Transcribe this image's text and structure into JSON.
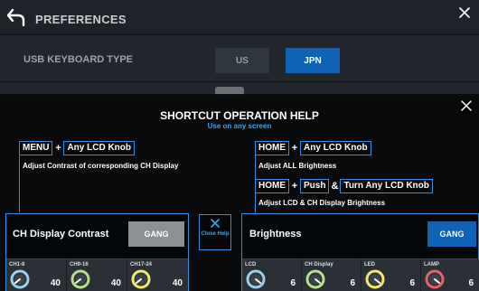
{
  "preferences": {
    "title": "PREFERENCES",
    "usb_keyboard_label": "USB KEYBOARD TYPE",
    "options": [
      "US",
      "JPN"
    ],
    "selected": "JPN"
  },
  "help": {
    "title": "SHORTCUT OPERATION HELP",
    "subtitle": "Use on any screen",
    "left": {
      "key1": "MENU",
      "plus": "+",
      "key2": "Any LCD Knob",
      "desc": "Adjust Contrast of corresponding CH Display"
    },
    "right1": {
      "key1": "HOME",
      "plus": "+",
      "key2": "Any LCD Knob",
      "desc": "Adjust ALL Brightness"
    },
    "right2": {
      "key1": "HOME",
      "plus": "+",
      "key2": "Push",
      "amp": "&",
      "key3": "Turn Any LCD Knob",
      "desc": "Adjust LCD & CH Display Brightness"
    },
    "close_label": "Close Help"
  },
  "ch_display_contrast": {
    "title": "CH Display Contrast",
    "gang_label": "GANG",
    "gang_active": false,
    "knobs": [
      {
        "label": "CH1-8",
        "value": "40",
        "color": "#9bd0ee"
      },
      {
        "label": "CH9-16",
        "value": "40",
        "color": "#b6e08a"
      },
      {
        "label": "CH17-24",
        "value": "40",
        "color": "#f2e96a"
      }
    ]
  },
  "brightness": {
    "title": "Brightness",
    "gang_label": "GANG",
    "gang_active": true,
    "knobs": [
      {
        "label": "LCD",
        "value": "6",
        "color": "#9bd0ee"
      },
      {
        "label": "CH Display",
        "value": "6",
        "color": "#b6e08a"
      },
      {
        "label": "LED",
        "value": "6",
        "color": "#f2e96a"
      },
      {
        "label": "LAMP",
        "value": "6",
        "color": "#e8606a"
      }
    ]
  },
  "colors": {
    "accent_blue": "#0f63b6",
    "outline_blue": "#2b8fe0",
    "subtitle_blue": "#3aa6f0"
  }
}
